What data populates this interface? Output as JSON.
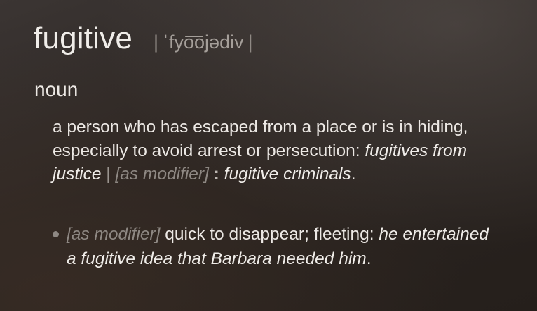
{
  "entry": {
    "headword": "fugitive",
    "pronunciation": {
      "bar_open": "|",
      "ipa": "ˈfyo͞ojədiv",
      "bar_close": "|"
    },
    "part_of_speech": "noun",
    "sense1": {
      "definition": "a person who has escaped from a place or is in hiding, especially to avoid arrest or persecution: ",
      "example1": "fugitives from justice",
      "separator": " | ",
      "modifier_label": "[as modifier]",
      "colon": " : ",
      "example2": "fugitive criminals",
      "end": "."
    },
    "sense2": {
      "modifier_label": "[as modifier]",
      "definition": " quick to disappear; fleeting: ",
      "example": "he entertained a fugitive idea that Barbara needed him",
      "end": "."
    }
  }
}
